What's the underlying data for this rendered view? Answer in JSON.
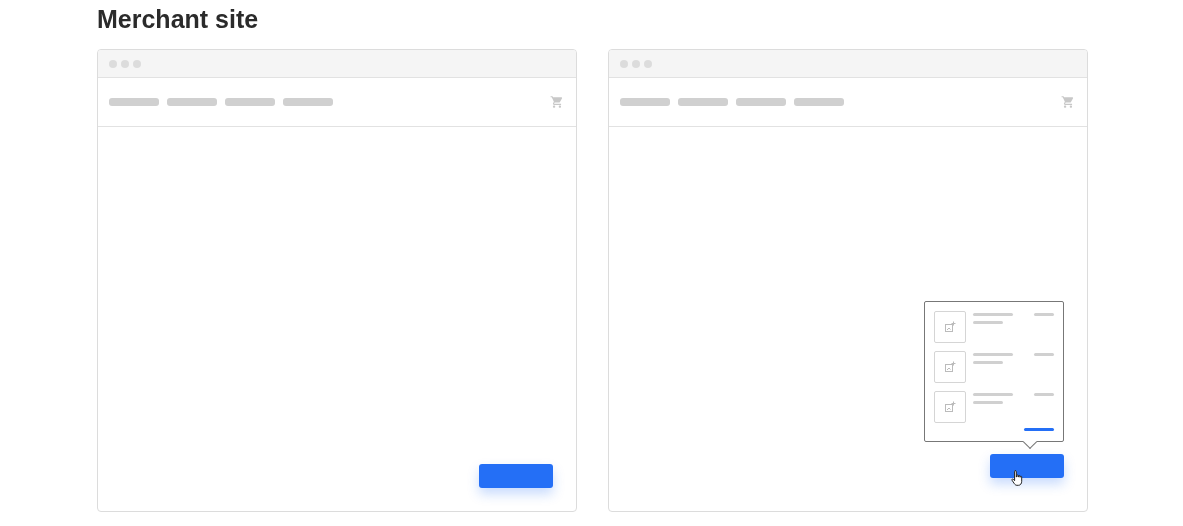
{
  "title": "Merchant site",
  "browsers": [
    {
      "cart_open": false,
      "pointer": false
    },
    {
      "cart_open": true,
      "pointer": true
    }
  ]
}
